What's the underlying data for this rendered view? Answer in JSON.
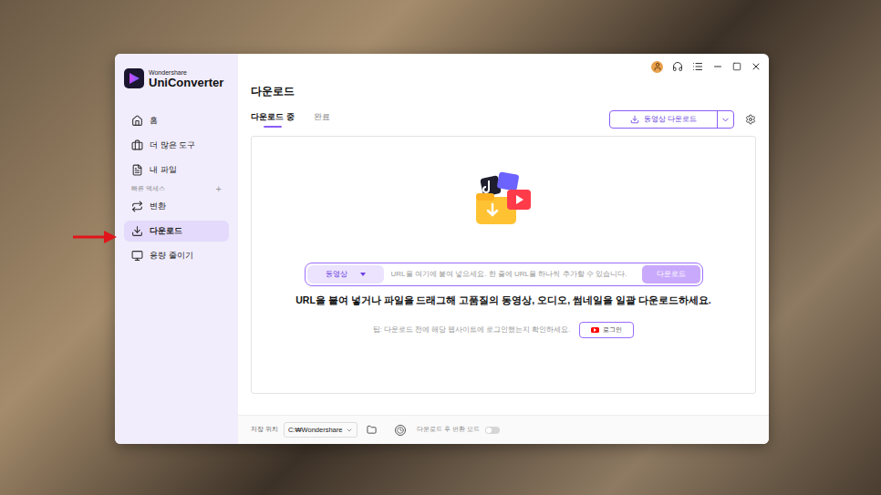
{
  "window": {
    "brand_top": "Wondershare",
    "brand_name": "UniConverter"
  },
  "sidebar": {
    "items": [
      {
        "label": "홈",
        "icon": "home",
        "selected": false
      },
      {
        "label": "더 많은 도구",
        "icon": "tools",
        "selected": false
      },
      {
        "label": "내 파일",
        "icon": "files",
        "selected": false
      }
    ],
    "section": {
      "label": "빠른 액세스",
      "add": "+"
    },
    "quick_items": [
      {
        "label": "변환",
        "icon": "convert",
        "selected": false
      },
      {
        "label": "다운로드",
        "icon": "download",
        "selected": true
      },
      {
        "label": "용량 줄이기",
        "icon": "compress",
        "selected": false
      }
    ]
  },
  "page": {
    "title": "다운로드"
  },
  "tabs": [
    {
      "label": "다운로드 중",
      "selected": true
    },
    {
      "label": "완료",
      "selected": false
    }
  ],
  "download_button": {
    "label": "동영상 다운로드"
  },
  "url_bar": {
    "type": "동영상",
    "placeholder": "URL을 여기에 붙여 넣으세요. 한 줄에 URL을 하나씩 추가할 수 있습니다.",
    "button": "다운로드"
  },
  "heading": "URL을 붙여 넣거나 파일을 드래그해 고품질의 동영상, 오디오, 썸네일을 일괄 다운로드하세요.",
  "tip": {
    "text": "팁: 다운로드 전에 해당 웹사이트에 로그인했는지 확인하세요.",
    "button": "로그인"
  },
  "footer": {
    "location_label": "저장 위치",
    "location_value": "C:₩Wondershare",
    "convert_mode_label": "다운로드 후 변환 모드",
    "convert_mode_on": false
  }
}
